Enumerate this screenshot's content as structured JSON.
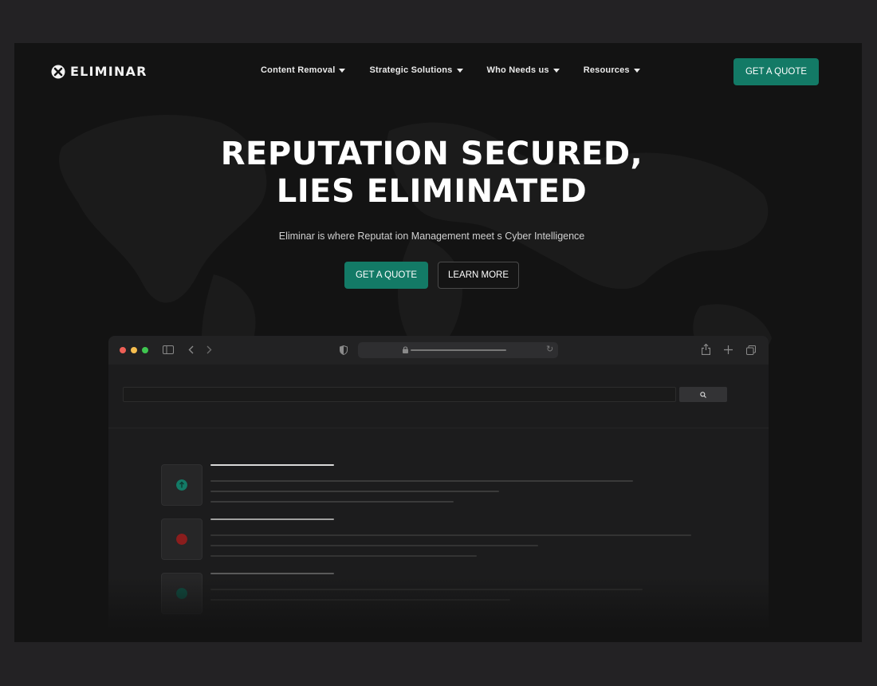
{
  "brand": {
    "name": "ELIMINAR"
  },
  "nav": {
    "items": [
      {
        "label": "Content Removal"
      },
      {
        "label": "Strategic Solutions"
      },
      {
        "label": "Who Needs us"
      },
      {
        "label": "Resources"
      }
    ],
    "cta_label": "GET A QUOTE"
  },
  "hero": {
    "title_line1": "REPUTATION SECURED,",
    "title_line2": "LIES ELIMINATED",
    "subtitle": "Eliminar is where Reputat ion Management meet s Cyber Intelligence",
    "primary_label": "GET A QUOTE",
    "secondary_label": "LEARN MORE"
  },
  "colors": {
    "accent": "#137a66",
    "background": "#131313",
    "result_positive": "#137a66",
    "result_negative": "#8a1d1d"
  },
  "icons": [
    "logo-x-icon",
    "caret-down-icon",
    "sidebar-icon",
    "back-icon",
    "forward-icon",
    "shield-icon",
    "lock-icon",
    "reload-icon",
    "share-icon",
    "plus-icon",
    "tabs-icon",
    "search-icon"
  ]
}
